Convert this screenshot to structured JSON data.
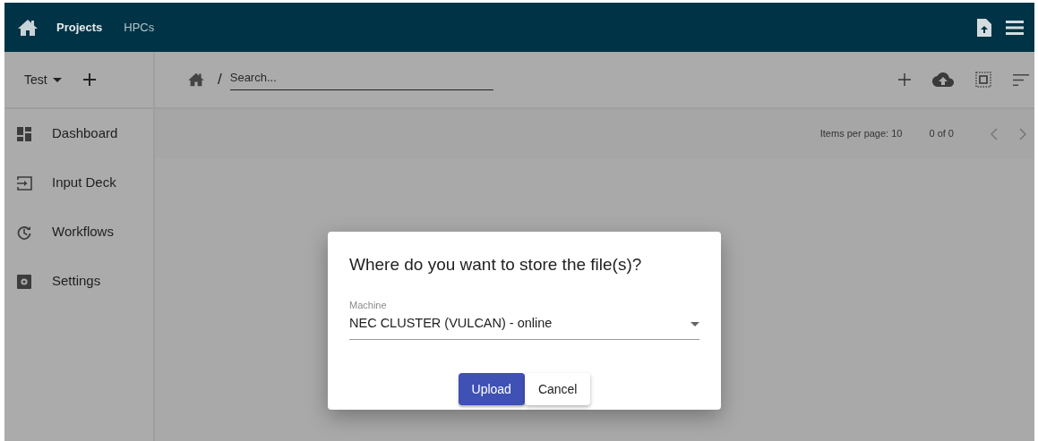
{
  "topbar": {
    "nav": [
      {
        "label": "Projects",
        "selected": true
      },
      {
        "label": "HPCs",
        "selected": false
      }
    ]
  },
  "project_selector": {
    "value": "Test"
  },
  "breadcrumb": {
    "separator": "/",
    "search": {
      "placeholder": "Search..."
    }
  },
  "sidebar": {
    "items": [
      {
        "label": "Dashboard",
        "kind": "dashboard"
      },
      {
        "label": "Input Deck",
        "kind": "input"
      },
      {
        "label": "Workflows",
        "kind": "history"
      },
      {
        "label": "Settings",
        "kind": "settings"
      }
    ]
  },
  "paginator": {
    "items_per_page": "Items per page: 10",
    "range": "0 of 0"
  },
  "dialog": {
    "title": "Where do you want to store the file(s)?",
    "field": {
      "label": "Machine",
      "value": "NEC CLUSTER (VULCAN) - online"
    },
    "buttons": [
      {
        "label": "Upload",
        "kind": "primary"
      },
      {
        "label": "Cancel",
        "kind": "secondary"
      }
    ]
  }
}
